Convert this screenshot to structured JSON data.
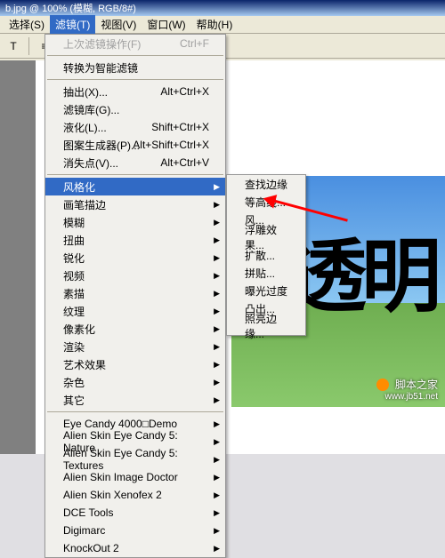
{
  "title": "b.jpg @ 100% (模糊, RGB/8#)",
  "menubar": [
    "选择(S)",
    "滤镜(T)",
    "视图(V)",
    "窗口(W)",
    "帮助(H)"
  ],
  "menubar_active": 1,
  "menu_main": {
    "top_disabled": {
      "label": "上次滤镜操作(F)",
      "shortcut": "Ctrl+F"
    },
    "single": [
      {
        "label": "转换为智能滤镜"
      }
    ],
    "group1": [
      {
        "label": "抽出(X)...",
        "shortcut": "Alt+Ctrl+X"
      },
      {
        "label": "滤镜库(G)..."
      },
      {
        "label": "液化(L)...",
        "shortcut": "Shift+Ctrl+X"
      },
      {
        "label": "图案生成器(P)...",
        "shortcut": "Alt+Shift+Ctrl+X"
      },
      {
        "label": "消失点(V)...",
        "shortcut": "Alt+Ctrl+V"
      }
    ],
    "group2": [
      {
        "label": "风格化",
        "submenu": true,
        "highlight": true
      },
      {
        "label": "画笔描边",
        "submenu": true
      },
      {
        "label": "模糊",
        "submenu": true
      },
      {
        "label": "扭曲",
        "submenu": true
      },
      {
        "label": "锐化",
        "submenu": true
      },
      {
        "label": "视频",
        "submenu": true
      },
      {
        "label": "素描",
        "submenu": true
      },
      {
        "label": "纹理",
        "submenu": true
      },
      {
        "label": "像素化",
        "submenu": true
      },
      {
        "label": "渲染",
        "submenu": true
      },
      {
        "label": "艺术效果",
        "submenu": true
      },
      {
        "label": "杂色",
        "submenu": true
      },
      {
        "label": "其它",
        "submenu": true
      }
    ],
    "group3": [
      {
        "label": "Eye Candy 4000□Demo",
        "submenu": true
      },
      {
        "label": "Alien Skin Eye Candy 5: Nature",
        "submenu": true
      },
      {
        "label": "Alien Skin Eye Candy 5: Textures",
        "submenu": true
      },
      {
        "label": "Alien Skin Image Doctor",
        "submenu": true
      },
      {
        "label": "Alien Skin Xenofex 2",
        "submenu": true
      },
      {
        "label": "DCE Tools",
        "submenu": true
      },
      {
        "label": "Digimarc",
        "submenu": true
      },
      {
        "label": "KnockOut 2",
        "submenu": true
      }
    ]
  },
  "submenu": [
    {
      "label": "查找边缘"
    },
    {
      "label": "等高线..."
    },
    {
      "label": "风..."
    },
    {
      "label": "浮雕效果..."
    },
    {
      "label": "扩散..."
    },
    {
      "label": "拼贴..."
    },
    {
      "label": "曝光过度"
    },
    {
      "label": "凸出..."
    },
    {
      "label": "照亮边缘..."
    }
  ],
  "canvas_text": "透明",
  "watermark": "脚本之家",
  "watermark_url": "www.jb51.net"
}
